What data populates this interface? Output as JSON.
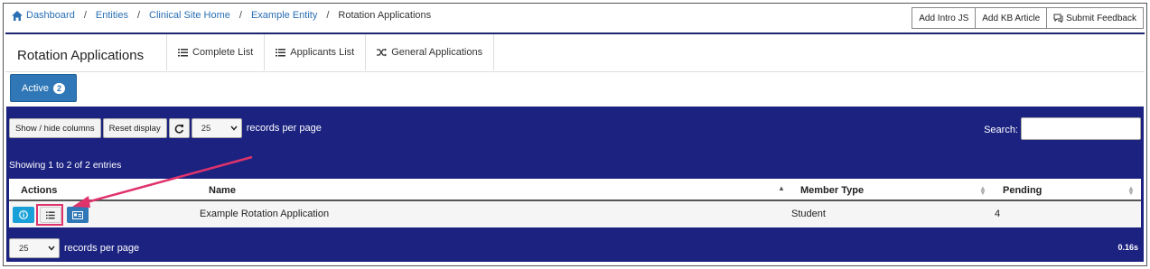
{
  "breadcrumb": {
    "items": [
      "Dashboard",
      "Entities",
      "Clinical Site Home",
      "Example Entity"
    ],
    "current": "Rotation Applications",
    "separator": "/"
  },
  "top_actions": {
    "intro_js": "Add Intro JS",
    "kb_article": "Add KB Article",
    "feedback": "Submit Feedback"
  },
  "header": {
    "title": "Rotation Applications",
    "tabs": [
      {
        "label": "Complete List",
        "icon": "list-icon"
      },
      {
        "label": "Applicants List",
        "icon": "list-icon"
      },
      {
        "label": "General Applications",
        "icon": "shuffle-icon"
      }
    ]
  },
  "filter": {
    "active_label": "Active",
    "active_count": "2"
  },
  "controls": {
    "show_hide": "Show / hide columns",
    "reset": "Reset display",
    "page_size": "25",
    "records_per_page": "records per page",
    "search_label": "Search:",
    "search_value": ""
  },
  "summary": "Showing 1 to 2 of 2 entries",
  "table": {
    "columns": [
      "Actions",
      "Name",
      "Member Type",
      "Pending"
    ],
    "rows": [
      {
        "name": "Example Rotation Application",
        "member_type": "Student",
        "pending": "4"
      }
    ]
  },
  "footer": {
    "page_size": "25",
    "records_per_page": "records per page",
    "timing": "0.16s"
  },
  "colors": {
    "navy": "#1b2280",
    "accent_blue": "#2f77b6",
    "info_blue": "#19a0d8",
    "highlight_pink": "#e0336b"
  }
}
